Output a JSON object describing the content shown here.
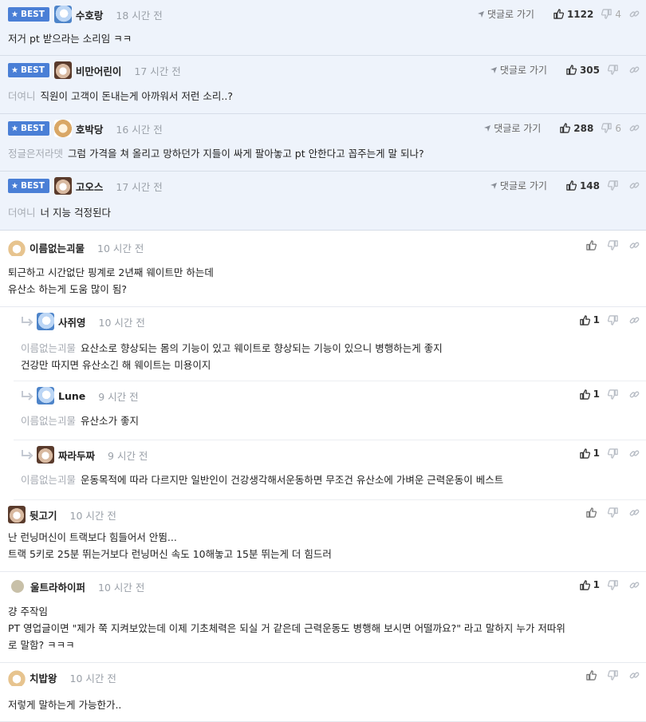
{
  "ui": {
    "best_label": "BEST",
    "reply_link_label": "댓글로 가기"
  },
  "colors": {
    "accent": "#4a7fd6",
    "best_bg": "#eef3fb",
    "muted": "#9aa0a8"
  },
  "comments": [
    {
      "best": true,
      "avatar": "avatar-blue-icon",
      "nick": "수호랑",
      "time": "18 시간 전",
      "likes": "1122",
      "dislikes": "4",
      "mention": "",
      "lines": [
        "저거 pt 받으라는 소리임 ㅋㅋ"
      ]
    },
    {
      "best": true,
      "avatar": "avatar-dog-icon",
      "nick": "비만어린이",
      "time": "17 시간 전",
      "likes": "305",
      "dislikes": "",
      "mention": "더여니",
      "lines": [
        "직원이 고객이 돈내는게 아까워서 저런 소리..?"
      ]
    },
    {
      "best": true,
      "avatar": "avatar-pup-icon",
      "nick": "호박당",
      "time": "16 시간 전",
      "likes": "288",
      "dislikes": "6",
      "mention": "정글은저라뎃",
      "lines": [
        "그럼 가격을 쳐 올리고 망하던가 지들이 싸게 팔아놓고 pt 안한다고 꼽주는게 말 되나?"
      ]
    },
    {
      "best": true,
      "avatar": "avatar-dog-icon",
      "nick": "고오스",
      "time": "17 시간 전",
      "likes": "148",
      "dislikes": "",
      "mention": "더여니",
      "lines": [
        "너 지능 걱정된다"
      ]
    },
    {
      "best": false,
      "avatar": "avatar-fox-icon",
      "nick": "이름없는괴물",
      "time": "10 시간 전",
      "likes": "",
      "dislikes": "",
      "mention": "",
      "lines": [
        "퇴근하고 시간없단 핑계로 2년째 웨이트만 하는데",
        "유산소 하는게 도움 많이 됨?"
      ]
    },
    {
      "best": false,
      "reply": true,
      "avatar": "avatar-blue-icon",
      "nick": "사쥐영",
      "time": "10 시간 전",
      "likes": "1",
      "dislikes": "",
      "mention": "이름없는괴물",
      "lines": [
        "요산소로 향상되는 몸의 기능이 있고 웨이트로 향상되는 기능이 있으니 병행하는게 좋지",
        "건강만 따지면 유산소긴 해 웨이트는 미용이지"
      ]
    },
    {
      "best": false,
      "reply": true,
      "avatar": "avatar-blue-icon",
      "nick": "Lune",
      "time": "9 시간 전",
      "likes": "1",
      "dislikes": "",
      "mention": "이름없는괴물",
      "lines": [
        "유산소가 좋지"
      ]
    },
    {
      "best": false,
      "reply": true,
      "avatar": "avatar-dog-icon",
      "nick": "짜라두짜",
      "time": "9 시간 전",
      "likes": "1",
      "dislikes": "",
      "mention": "이름없는괴물",
      "lines": [
        "운동목적에 따라 다르지만 일반인이 건강생각해서운동하면 무조건 유산소에 가벼운 근력운동이 베스트"
      ]
    },
    {
      "best": false,
      "avatar": "avatar-dog-icon",
      "nick": "뒷고기",
      "time": "10 시간 전",
      "likes": "",
      "dislikes": "",
      "mention": "",
      "lines": [
        "난 런닝머신이 트랙보다 힘들어서 안뜀...",
        "트랙 5키로 25분 뛰는거보다 런닝머신 속도 10해놓고 15분 뛰는게 더 힘드러"
      ]
    },
    {
      "best": false,
      "avatar": "avatar-default-icon",
      "nick": "울트라하이퍼",
      "time": "10 시간 전",
      "likes": "1",
      "dislikes": "",
      "mention": "",
      "lines": [
        "걍 주작임",
        "PT 영업글이면 \"제가 쭉 지켜보았는데 이제 기초체력은 되실 거 같은데 근력운동도 병행해 보시면 어떨까요?\" 라고 말하지 누가 저따위",
        "로 말함? ㅋㅋㅋ"
      ]
    },
    {
      "best": false,
      "avatar": "avatar-fox-icon",
      "nick": "치밥왕",
      "time": "10 시간 전",
      "likes": "",
      "dislikes": "",
      "mention": "",
      "lines": [
        "저렇게 말하는게 가능한가.."
      ]
    }
  ]
}
